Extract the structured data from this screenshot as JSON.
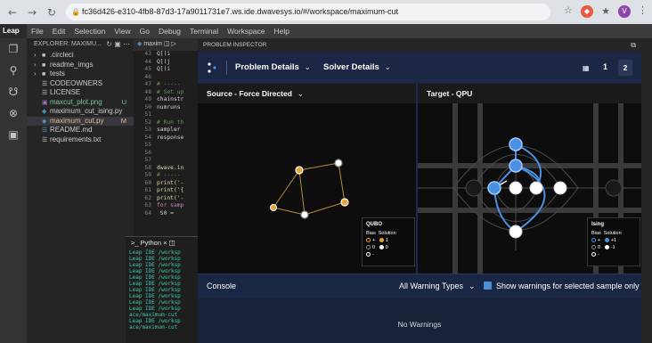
{
  "browser": {
    "url": "fc36d426-e310-4fb8-87d3-17a9011731e7.ws.ide.dwavesys.io/#/workspace/maximum-cut",
    "profile_initial": "V"
  },
  "menu": {
    "logo": "Leap",
    "items": [
      "File",
      "Edit",
      "Selection",
      "View",
      "Go",
      "Debug",
      "Terminal",
      "Workspace",
      "Help"
    ]
  },
  "explorer": {
    "title": "EXPLORER: MAXIMU...",
    "items": [
      {
        "label": ".circleci",
        "type": "folder",
        "badge": ""
      },
      {
        "label": "readme_imgs",
        "type": "folder",
        "badge": ""
      },
      {
        "label": "tests",
        "type": "folder",
        "badge": ""
      },
      {
        "label": "CODEOWNERS",
        "type": "file",
        "badge": ""
      },
      {
        "label": "LICENSE",
        "type": "file",
        "badge": ""
      },
      {
        "label": "maxcut_plot.png",
        "type": "image",
        "badge": "U"
      },
      {
        "label": "maximum_cut_ising.py",
        "type": "python",
        "badge": ""
      },
      {
        "label": "maximum_cut.py",
        "type": "python",
        "badge": "M"
      },
      {
        "label": "README.md",
        "type": "file",
        "badge": ""
      },
      {
        "label": "requirements.txt",
        "type": "file",
        "badge": ""
      }
    ]
  },
  "editor": {
    "tab": "maxim",
    "lines": [
      {
        "n": "43",
        "t": "Q[(i"
      },
      {
        "n": "44",
        "t": "Q[(j"
      },
      {
        "n": "45",
        "t": "Q[(i"
      },
      {
        "n": "46",
        "t": ""
      },
      {
        "n": "47",
        "t": "# -----"
      },
      {
        "n": "48",
        "t": "# Set up"
      },
      {
        "n": "49",
        "t": "chainstr"
      },
      {
        "n": "50",
        "t": "numruns"
      },
      {
        "n": "51",
        "t": ""
      },
      {
        "n": "52",
        "t": "# Run th"
      },
      {
        "n": "53",
        "t": "sampler"
      },
      {
        "n": "54",
        "t": "response"
      },
      {
        "n": "55",
        "t": ""
      },
      {
        "n": "56",
        "t": ""
      },
      {
        "n": "57",
        "t": ""
      },
      {
        "n": "58",
        "t": "dwave.in"
      },
      {
        "n": "59",
        "t": "# -----"
      },
      {
        "n": "60",
        "t": "print('-"
      },
      {
        "n": "61",
        "t": "print('{"
      },
      {
        "n": "62",
        "t": "print('-"
      },
      {
        "n": "63",
        "t": "for samp"
      },
      {
        "n": "64",
        "t": "    S0 ="
      }
    ]
  },
  "terminal": {
    "tab": "Python",
    "lines": [
      "Leap IDE /worksp",
      "Leap IDE /worksp",
      "Leap IDE /worksp",
      "Leap IDE /worksp",
      "Leap IDE /worksp",
      "Leap IDE /worksp",
      "Leap IDE /worksp",
      "Leap IDE /worksp",
      "Leap IDE /worksp",
      "Leap IDE /worksp",
      "ace/maximum-cut",
      "Leap IDE /worksp",
      "ace/maximum-cut"
    ]
  },
  "inspector": {
    "header": "PROBLEM INSPECTOR",
    "tabs": [
      "Problem Details",
      "Solver Details"
    ],
    "sample_current": "1",
    "sample_total": "2",
    "source_title": "Source - Force Directed",
    "target_title": "Target - QPU",
    "qubo_legend": {
      "title": "QUBO",
      "cols": [
        "Bias",
        "Solution"
      ],
      "rows": [
        [
          "+",
          "1"
        ],
        [
          "0",
          "0"
        ],
        [
          "-",
          ""
        ]
      ]
    },
    "ising_legend": {
      "title": "Ising",
      "cols": [
        "Bias",
        "Solution"
      ],
      "rows": [
        [
          "+",
          "+1"
        ],
        [
          "0",
          "-1"
        ],
        [
          "-",
          ""
        ]
      ]
    },
    "console_label": "Console",
    "warning_select": "All Warning Types",
    "show_warnings_label": "Show warnings for selected sample only",
    "no_warnings": "No Warnings"
  },
  "colors": {
    "orange": "#e8a33a",
    "blue": "#4a90e2",
    "navy": "#1c2745"
  }
}
